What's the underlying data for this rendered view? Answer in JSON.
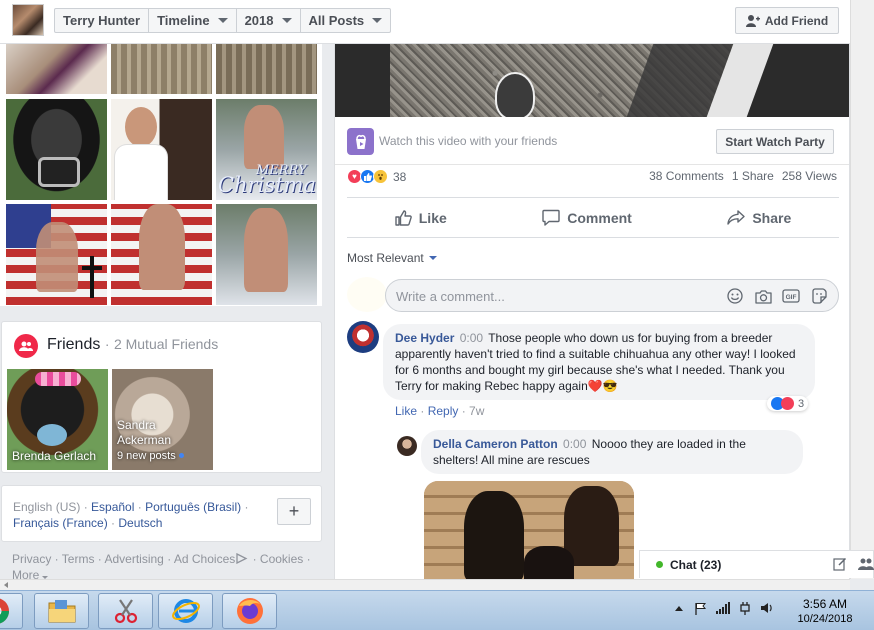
{
  "header": {
    "crumbs": [
      {
        "label": "Terry Hunter",
        "caret": false
      },
      {
        "label": "Timeline",
        "caret": true
      },
      {
        "label": "2018",
        "caret": true
      },
      {
        "label": "All Posts",
        "caret": true
      }
    ],
    "add_friend": "Add Friend"
  },
  "photos": {
    "captions": [
      "MERRY",
      "Christmas"
    ]
  },
  "friends": {
    "title": "Friends",
    "separator": "·",
    "mutual": "2 Mutual Friends",
    "tiles": [
      {
        "name": "Brenda Gerlach"
      },
      {
        "name_line1": "Sandra",
        "name_line2": "Ackerman",
        "new_posts": "9 new posts"
      }
    ]
  },
  "languages": {
    "current": "English (US)",
    "others": [
      "Español",
      "Português (Brasil)",
      "Français (France)",
      "Deutsch"
    ],
    "separator": " · "
  },
  "footer": {
    "links": [
      "Privacy",
      "Terms",
      "Advertising",
      "Ad Choices",
      "Cookies",
      "More"
    ],
    "separator": " · "
  },
  "post": {
    "watch_text": "Watch this video with your friends",
    "watch_button": "Start Watch Party",
    "reaction_count": "38",
    "comments": "38 Comments",
    "shares": "1 Share",
    "views": "258 Views",
    "actions": {
      "like": "Like",
      "comment": "Comment",
      "share": "Share"
    },
    "sort_label": "Most Relevant",
    "comment_placeholder": "Write a comment...",
    "comment_list": [
      {
        "author": "Dee Hyder",
        "time": "0:00",
        "text": "Those people who down us for buying from a breeder apparently haven't tried to find a suitable chihuahua any other way! I looked for 6 months and bought my girl because she's what I needed. Thank you Terry for making Rebec happy again",
        "emoji": "❤️😎",
        "like": "Like",
        "reply": "Reply",
        "age": "7w",
        "reactions": "3"
      },
      {
        "author": "Della Cameron Patton",
        "time": "0:00",
        "text": "Noooo they are loaded in the shelters! All mine are rescues"
      }
    ]
  },
  "chat": {
    "label": "Chat (23)"
  },
  "taskbar": {
    "time": "3:56 AM",
    "date": "10/24/2018"
  },
  "colors": {
    "fb_blue": "#4267b2",
    "link_blue": "#385898",
    "friends_pink": "#f02849",
    "watch_purple": "#8c72cb",
    "chat_green": "#42b72a"
  }
}
